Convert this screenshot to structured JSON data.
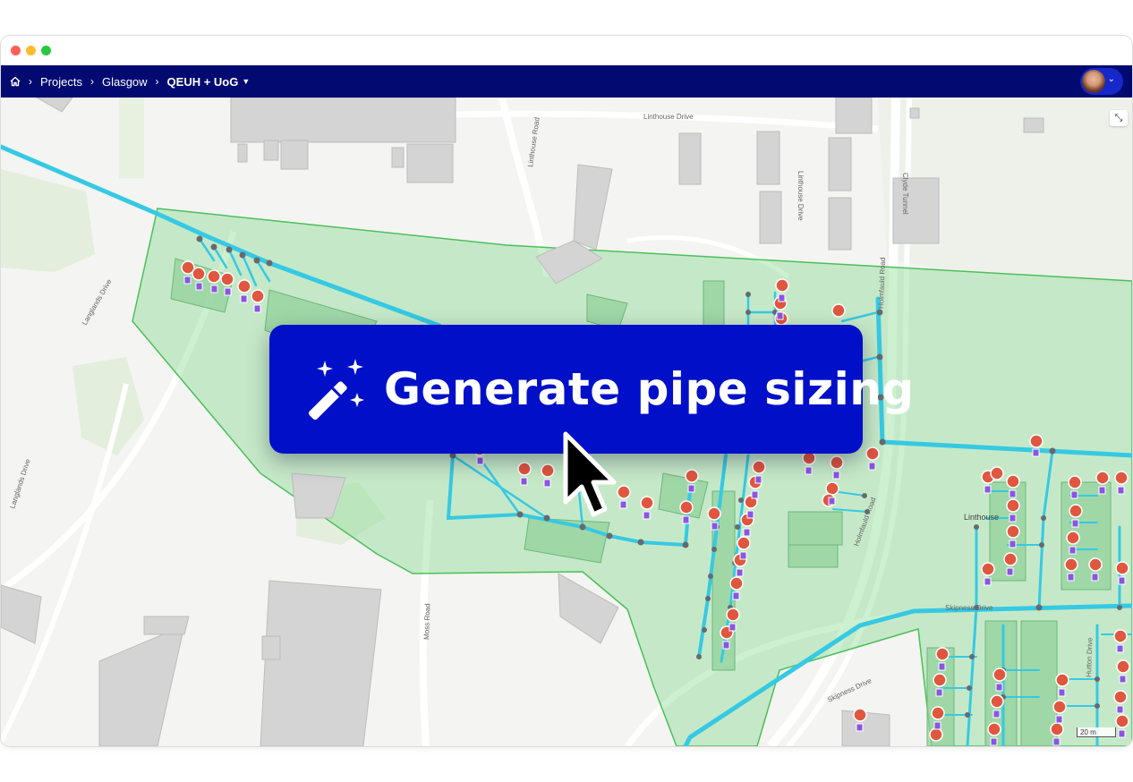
{
  "breadcrumbs": {
    "home_icon": "home-icon",
    "items": [
      "Projects",
      "Glasgow"
    ],
    "current": "QEUH + UoG"
  },
  "user": {
    "avatar_icon": "user-avatar",
    "caret_icon": "chevron-down-icon"
  },
  "map": {
    "streets": {
      "linthouse_drive": "Linthouse Drive",
      "linthouse_road": "Linthouse Road",
      "linthouse_drive_vertical": "Linthouse Drive",
      "clyde_tunnel": "Clyde Tunnel",
      "holmfauld_road": "Holmfauld Road",
      "langlands_drive": "Langlands Drive",
      "langlands_drive_2": "Langlands Drive",
      "moss_road": "Moss Road",
      "skipness_drive": "Skipness Drive",
      "skipness_drive_2": "Skipness Drive",
      "hutton_drive": "Hutton Drive",
      "linthouse_area": "Linthouse",
      "holmfauld_road_2": "Holmfauld Road"
    },
    "scale_label": "20 m",
    "colors": {
      "pipe": "#36c9e3",
      "zone_fill": "#7fd98a",
      "zone_stroke": "#4cbf5a",
      "house_marker": "#e0563f",
      "meter_marker": "#8a55e0"
    }
  },
  "overlay": {
    "label": "Generate pipe sizing",
    "icon": "magic-wand-icon",
    "cursor_icon": "mouse-cursor-icon"
  }
}
